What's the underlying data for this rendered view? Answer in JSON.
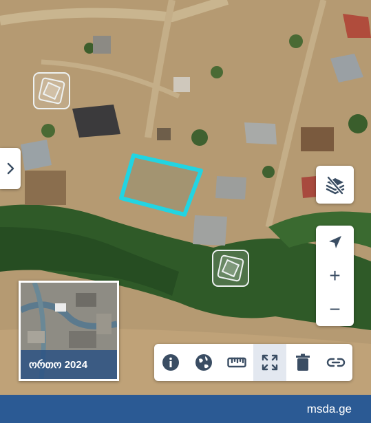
{
  "map": {
    "parcel_outline_color": "#22d4e2",
    "vegetation_color": "#2f5a28",
    "ground_color": "#b59a72"
  },
  "minimap": {
    "label": "ორთო 2024"
  },
  "controls": {
    "side_toggle_icon": "chevron-right-icon",
    "layer_toggle_icon": "layers-off-icon",
    "locate_icon": "navigation-arrow-icon",
    "zoom_in_label": "+",
    "zoom_out_label": "−"
  },
  "toolbar": {
    "tools": [
      {
        "icon": "info-icon"
      },
      {
        "icon": "globe-icon"
      },
      {
        "icon": "ruler-icon"
      },
      {
        "icon": "fullscreen-icon",
        "active": true
      },
      {
        "icon": "trash-icon"
      },
      {
        "icon": "link-icon"
      }
    ]
  },
  "footer": {
    "site": "msda.ge",
    "color": "#2b5a94"
  }
}
